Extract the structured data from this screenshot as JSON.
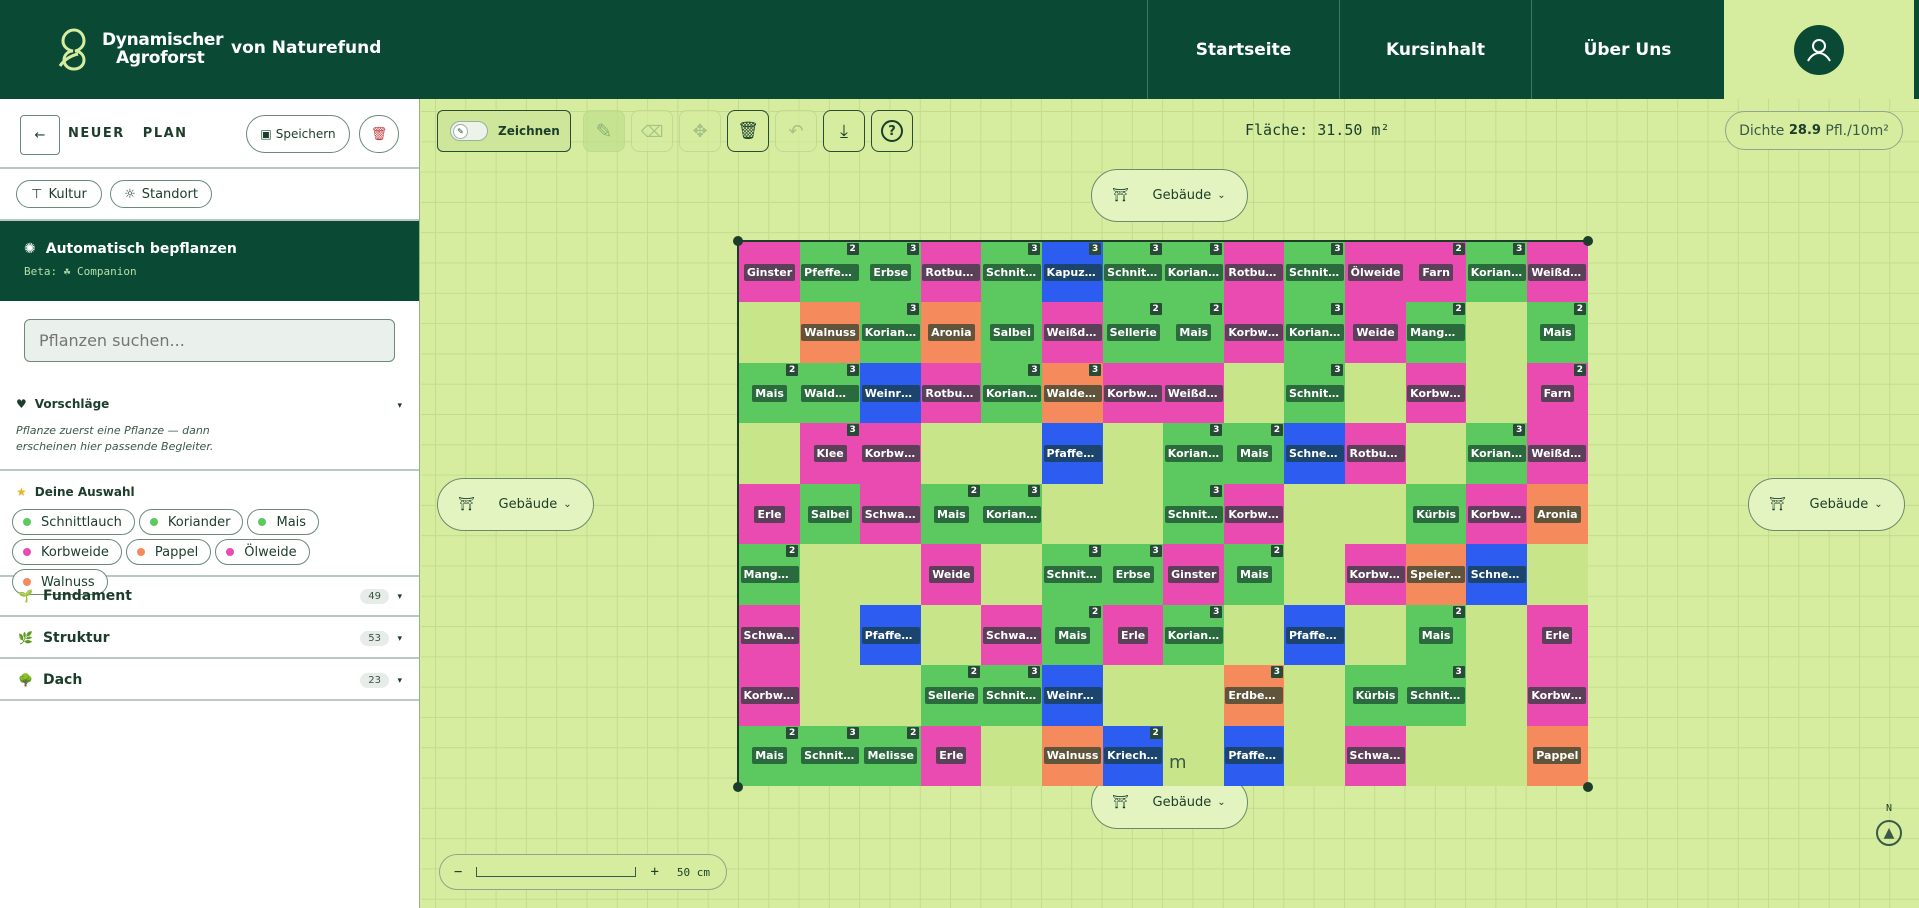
{
  "header": {
    "logo_line1": "Dynamischer",
    "logo_line2": "Agroforst",
    "by": "von Naturefund",
    "nav": [
      "Startseite",
      "Kursinhalt",
      "Über Uns"
    ]
  },
  "sidebar": {
    "back_label": "←",
    "title_1": "NEUER",
    "title_2": "PLAN",
    "save_label": "Speichern",
    "filter_culture": "Kultur",
    "filter_location": "Standort",
    "auto": {
      "title": "Automatisch bepflanzen",
      "sub": "Beta: ☘ Companion"
    },
    "search_placeholder": "Pflanzen suchen...",
    "suggestions": {
      "title": "Vorschläge",
      "text_1": "Pflanze zuerst eine Pflanze — dann",
      "text_2": "erscheinen hier passende Begleiter."
    },
    "selection": {
      "title": "Deine Auswahl",
      "chips": [
        {
          "name": "Schnittlauch",
          "color": "#5cc860"
        },
        {
          "name": "Koriander",
          "color": "#5cc860"
        },
        {
          "name": "Mais",
          "color": "#5cc860"
        },
        {
          "name": "Korbweide",
          "color": "#e94bb0"
        },
        {
          "name": "Pappel",
          "color": "#f58a5c"
        },
        {
          "name": "Ölweide",
          "color": "#e94bb0"
        },
        {
          "name": "Walnuss",
          "color": "#f58a5c"
        }
      ]
    },
    "categories": [
      {
        "label": "Fundament",
        "count": "49"
      },
      {
        "label": "Struktur",
        "count": "53"
      },
      {
        "label": "Dach",
        "count": "23"
      }
    ]
  },
  "toolbar": {
    "draw_label": "Zeichnen",
    "area": "Fläche: 31.50 m²",
    "density_prefix": "Dichte",
    "density_value": "28.9",
    "density_unit": "Pfl./10m²"
  },
  "building_label": "Gebäude",
  "scale": {
    "minus": "−",
    "plus": "+",
    "label": "50 cm"
  },
  "compass": "N",
  "grid_mark": "m",
  "colors": {
    "G": "#5cc860",
    "P": "#e94bb0",
    "B": "#2d5cf0",
    "O": "#f58a5c",
    "E": "#c8e58a"
  },
  "grid": [
    [
      [
        "Ginster",
        "P",
        ""
      ],
      [
        "Pfefferm…",
        "G",
        "2"
      ],
      [
        "Erbse",
        "G",
        "3"
      ],
      [
        "Rotbuche",
        "P",
        ""
      ],
      [
        "Schnitt…",
        "G",
        "3"
      ],
      [
        "Kapuzine…",
        "B",
        "3"
      ],
      [
        "Schnitt…",
        "G",
        "3"
      ],
      [
        "Koriander",
        "G",
        "3"
      ],
      [
        "Rotbuche",
        "P",
        ""
      ],
      [
        "Schnitt…",
        "G",
        "3"
      ],
      [
        "Ölweide",
        "P",
        ""
      ],
      [
        "Farn",
        "P",
        "2"
      ],
      [
        "Koriander",
        "G",
        "3"
      ],
      [
        "Weißdorn",
        "P",
        ""
      ]
    ],
    [
      [
        "",
        "E",
        ""
      ],
      [
        "Walnuss",
        "O",
        ""
      ],
      [
        "Koriander",
        "G",
        "3"
      ],
      [
        "Aronia",
        "O",
        ""
      ],
      [
        "Salbei",
        "G",
        ""
      ],
      [
        "Weißdorn",
        "P",
        ""
      ],
      [
        "Sellerie",
        "G",
        "2"
      ],
      [
        "Mais",
        "G",
        "2"
      ],
      [
        "Korbweide",
        "P",
        ""
      ],
      [
        "Koriander",
        "G",
        "3"
      ],
      [
        "Weide",
        "P",
        ""
      ],
      [
        "Mangold",
        "G",
        "2"
      ],
      [
        "",
        "E",
        ""
      ],
      [
        "Mais",
        "G",
        "2"
      ]
    ],
    [
      [
        "Mais",
        "G",
        "2"
      ],
      [
        "Waldmeis…",
        "G",
        "3"
      ],
      [
        "Weinrose",
        "B",
        ""
      ],
      [
        "Rotbuche",
        "P",
        ""
      ],
      [
        "Koriander",
        "G",
        "3"
      ],
      [
        "Walderdb…",
        "O",
        "3"
      ],
      [
        "Korbweide",
        "P",
        ""
      ],
      [
        "Weißdorn",
        "P",
        ""
      ],
      [
        "",
        "E",
        ""
      ],
      [
        "Schnitt…",
        "G",
        "3"
      ],
      [
        "",
        "E",
        ""
      ],
      [
        "Korbweide",
        "P",
        ""
      ],
      [
        "",
        "E",
        ""
      ],
      [
        "Farn",
        "P",
        "2"
      ]
    ],
    [
      [
        "",
        "E",
        ""
      ],
      [
        "Klee",
        "P",
        "3"
      ],
      [
        "Korbweide",
        "P",
        ""
      ],
      [
        "",
        "E",
        ""
      ],
      [
        "",
        "E",
        ""
      ],
      [
        "Pfaffenh…",
        "B",
        ""
      ],
      [
        "",
        "E",
        ""
      ],
      [
        "Koriander",
        "G",
        "3"
      ],
      [
        "Mais",
        "G",
        "2"
      ],
      [
        "Schneeba…",
        "B",
        ""
      ],
      [
        "Rotbuche",
        "P",
        ""
      ],
      [
        "",
        "E",
        ""
      ],
      [
        "Koriander",
        "G",
        "3"
      ],
      [
        "Weißdorn",
        "P",
        ""
      ]
    ],
    [
      [
        "Erle",
        "P",
        ""
      ],
      [
        "Salbei",
        "G",
        ""
      ],
      [
        "Schwarze…",
        "P",
        ""
      ],
      [
        "Mais",
        "G",
        "2"
      ],
      [
        "Koriander",
        "G",
        "3"
      ],
      [
        "",
        "E",
        ""
      ],
      [
        "",
        "E",
        ""
      ],
      [
        "Schnitt…",
        "G",
        "3"
      ],
      [
        "Korbweide",
        "P",
        ""
      ],
      [
        "",
        "E",
        ""
      ],
      [
        "",
        "E",
        ""
      ],
      [
        "Kürbis",
        "G",
        ""
      ],
      [
        "Korbweide",
        "P",
        ""
      ],
      [
        "Aronia",
        "O",
        ""
      ]
    ],
    [
      [
        "Mangold",
        "G",
        "2"
      ],
      [
        "",
        "E",
        ""
      ],
      [
        "",
        "E",
        ""
      ],
      [
        "Weide",
        "P",
        ""
      ],
      [
        "",
        "E",
        ""
      ],
      [
        "Schnitt…",
        "G",
        "3"
      ],
      [
        "Erbse",
        "G",
        "3"
      ],
      [
        "Ginster",
        "P",
        ""
      ],
      [
        "Mais",
        "G",
        "2"
      ],
      [
        "",
        "E",
        ""
      ],
      [
        "Korbweide",
        "P",
        ""
      ],
      [
        "Speierli…",
        "O",
        ""
      ],
      [
        "Schneeba…",
        "B",
        ""
      ],
      [
        "",
        "E",
        ""
      ]
    ],
    [
      [
        "Schwarze…",
        "P",
        ""
      ],
      [
        "",
        "E",
        ""
      ],
      [
        "Pfaffenh…",
        "B",
        ""
      ],
      [
        "",
        "E",
        ""
      ],
      [
        "Schwarze…",
        "P",
        ""
      ],
      [
        "Mais",
        "G",
        "2"
      ],
      [
        "Erle",
        "P",
        ""
      ],
      [
        "Koriander",
        "G",
        "3"
      ],
      [
        "",
        "E",
        ""
      ],
      [
        "Pfaffenh…",
        "B",
        ""
      ],
      [
        "",
        "E",
        ""
      ],
      [
        "Mais",
        "G",
        "2"
      ],
      [
        "",
        "E",
        ""
      ],
      [
        "Erle",
        "P",
        ""
      ]
    ],
    [
      [
        "Korbweide",
        "P",
        ""
      ],
      [
        "",
        "E",
        ""
      ],
      [
        "",
        "E",
        ""
      ],
      [
        "Sellerie",
        "G",
        "2"
      ],
      [
        "Schnitt…",
        "G",
        "3"
      ],
      [
        "Weinrose",
        "B",
        ""
      ],
      [
        "",
        "E",
        ""
      ],
      [
        "",
        "E",
        ""
      ],
      [
        "Erdbeere",
        "O",
        "3"
      ],
      [
        "",
        "E",
        ""
      ],
      [
        "Kürbis",
        "G",
        ""
      ],
      [
        "Schnitt…",
        "G",
        "3"
      ],
      [
        "",
        "E",
        ""
      ],
      [
        "Korbweide",
        "P",
        ""
      ]
    ],
    [
      [
        "Mais",
        "G",
        "2"
      ],
      [
        "Schnitt…",
        "G",
        "3"
      ],
      [
        "Melisse",
        "G",
        "2"
      ],
      [
        "Erle",
        "P",
        ""
      ],
      [
        "",
        "E",
        ""
      ],
      [
        "Walnuss",
        "O",
        ""
      ],
      [
        "Kriechen…",
        "B",
        "2"
      ],
      [
        "",
        "E",
        ""
      ],
      [
        "Pfaffenh…",
        "B",
        ""
      ],
      [
        "",
        "E",
        ""
      ],
      [
        "Schwarze…",
        "P",
        ""
      ],
      [
        "",
        "E",
        ""
      ],
      [
        "",
        "E",
        ""
      ],
      [
        "Pappel",
        "O",
        ""
      ]
    ]
  ]
}
